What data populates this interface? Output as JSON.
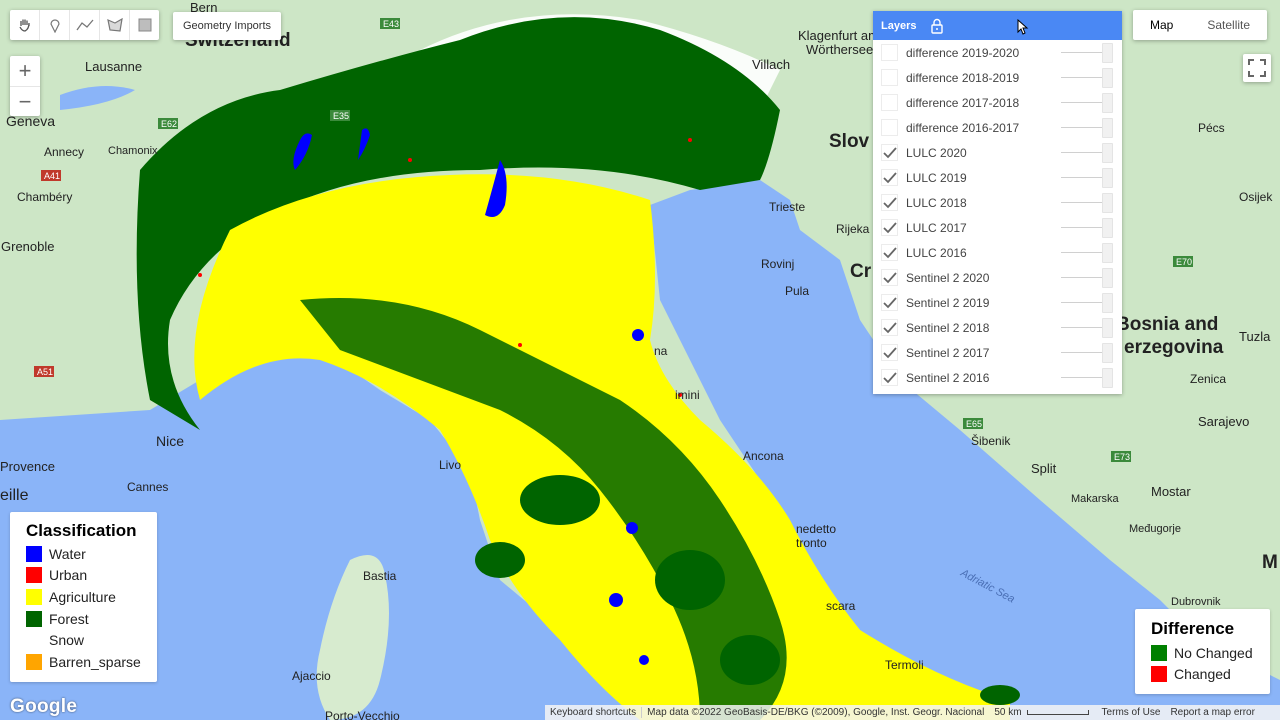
{
  "toolbar": {
    "geometry_imports_label": "Geometry Imports",
    "zoom_in": "+",
    "zoom_out": "−"
  },
  "map_type": {
    "map_label": "Map",
    "satellite_label": "Satellite",
    "active": "Map"
  },
  "layers_panel": {
    "title": "Layers",
    "layers": [
      {
        "name": "difference 2019-2020",
        "checked": false
      },
      {
        "name": "difference 2018-2019",
        "checked": false
      },
      {
        "name": "difference 2017-2018",
        "checked": false
      },
      {
        "name": "difference 2016-2017",
        "checked": false
      },
      {
        "name": "LULC 2020",
        "checked": true
      },
      {
        "name": "LULC 2019",
        "checked": true
      },
      {
        "name": "LULC 2018",
        "checked": true
      },
      {
        "name": "LULC 2017",
        "checked": true
      },
      {
        "name": "LULC 2016",
        "checked": true
      },
      {
        "name": "Sentinel 2 2020",
        "checked": true
      },
      {
        "name": "Sentinel 2 2019",
        "checked": true
      },
      {
        "name": "Sentinel 2 2018",
        "checked": true
      },
      {
        "name": "Sentinel 2 2017",
        "checked": true
      },
      {
        "name": "Sentinel 2 2016",
        "checked": true
      }
    ]
  },
  "legend_classification": {
    "title": "Classification",
    "items": [
      {
        "label": "Water",
        "color": "#0000ff"
      },
      {
        "label": "Urban",
        "color": "#ff0000"
      },
      {
        "label": "Agriculture",
        "color": "#ffff00"
      },
      {
        "label": "Forest",
        "color": "#006400"
      },
      {
        "label": "Snow",
        "color": "#ffffff"
      },
      {
        "label": "Barren_sparse",
        "color": "#ffa500"
      }
    ]
  },
  "legend_difference": {
    "title": "Difference",
    "items": [
      {
        "label": "No Changed",
        "color": "#008000"
      },
      {
        "label": "Changed",
        "color": "#ff0000"
      }
    ]
  },
  "map_labels": {
    "bern": "Bern",
    "switzerland": "Switzerland",
    "lausanne": "Lausanne",
    "geneva": "Geneva",
    "annecy": "Annecy",
    "chamonix": "Chamonix",
    "chambery": "Chambéry",
    "grenoble": "Grenoble",
    "nice": "Nice",
    "cannes": "Cannes",
    "provence": "Provence",
    "eille": "eille",
    "bastia": "Bastia",
    "ajaccio": "Ajaccio",
    "porto_vecchio": "Porto-Vecchio",
    "klagenfurt": "Klagenfurt am",
    "worthersee": "Wörthersee",
    "villach": "Villach",
    "slov": "Slov",
    "trieste": "Trieste",
    "rijeka": "Rijeka",
    "cr": "Cr",
    "rovinj": "Rovinj",
    "pula": "Pula",
    "pecs": "Pécs",
    "osijek": "Osijek",
    "bosnia1": "Bosnia and",
    "bosnia2": "erzegovina",
    "tuzla": "Tuzla",
    "zenica": "Zenica",
    "sarajevo": "Sarajevo",
    "sibenik": "Šibenik",
    "split": "Split",
    "makarska": "Makarska",
    "mostar": "Mostar",
    "medugorje": "Međugorje",
    "dubrovnik": "Dubrovnik",
    "m": "M",
    "adriatic_sea": "Adriatic Sea",
    "ancona": "Ancona",
    "termoli": "Termoli",
    "nedetto": "nedetto",
    "tronto": "tronto",
    "scara": "scara",
    "livo": "Livo",
    "imini": "imini",
    "na": "na",
    "e43": "E43",
    "e35": "E35",
    "e62": "E62",
    "a41": "A41",
    "a51": "A51",
    "e70": "E70",
    "e65": "E65",
    "e73": "E73"
  },
  "footer": {
    "google": "Google",
    "keyboard": "Keyboard shortcuts",
    "mapdata": "Map data ©2022 GeoBasis-DE/BKG (©2009), Google, Inst. Geogr. Nacional",
    "scale": "50 km",
    "terms": "Terms of Use",
    "report": "Report a map error"
  }
}
